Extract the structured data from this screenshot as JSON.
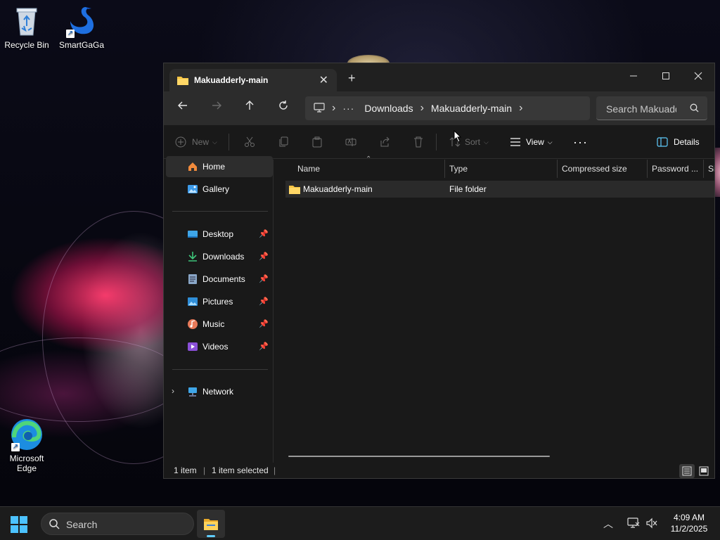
{
  "desktop": {
    "icons": [
      {
        "label": "Recycle Bin",
        "icon": "recycle-bin-icon"
      },
      {
        "label": "SmartGaGa",
        "icon": "swan-icon"
      },
      {
        "label": "Microsoft Edge",
        "icon": "edge-icon"
      }
    ]
  },
  "window": {
    "tab_title": "Makuadderly-main",
    "new_tab_symbol": "+",
    "nav": {
      "address": {
        "overflow": "···",
        "crumbs": [
          "Downloads",
          "Makuadderly-main"
        ]
      },
      "search_placeholder": "Search Makuadderly-main"
    },
    "toolbar": {
      "new_label": "New",
      "sort_label": "Sort",
      "view_label": "View",
      "more_label": "···",
      "details_label": "Details"
    },
    "sidebar": {
      "home": "Home",
      "gallery": "Gallery",
      "pinned": [
        "Desktop",
        "Downloads",
        "Documents",
        "Pictures",
        "Music",
        "Videos"
      ],
      "network": "Network"
    },
    "columns": [
      "Name",
      "Type",
      "Compressed size",
      "Password ...",
      "Si"
    ],
    "rows": [
      {
        "name": "Makuadderly-main",
        "type": "File folder"
      }
    ],
    "status": {
      "count": "1 item",
      "selected": "1 item selected"
    }
  },
  "taskbar": {
    "search_placeholder": "Search",
    "time": "4:09 AM",
    "date": "11/2/2025"
  },
  "colors": {
    "accent": "#60cdff",
    "folder": "#f5c342",
    "window_bg": "#191919",
    "navbar_bg": "#2c2c2c"
  }
}
